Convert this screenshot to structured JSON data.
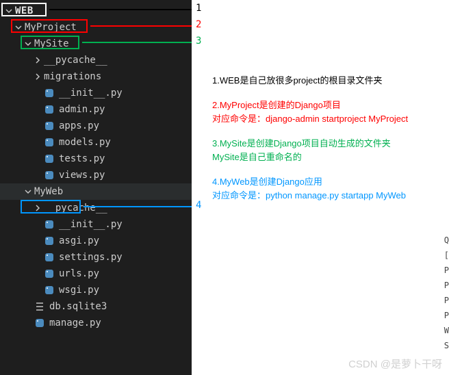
{
  "tree": {
    "root": "WEB",
    "project": "MyProject",
    "site": "MySite",
    "site_children": [
      {
        "name": "__pycache__",
        "type": "folder"
      },
      {
        "name": "migrations",
        "type": "folder"
      },
      {
        "name": "__init__.py",
        "type": "py"
      },
      {
        "name": "admin.py",
        "type": "py"
      },
      {
        "name": "apps.py",
        "type": "py"
      },
      {
        "name": "models.py",
        "type": "py"
      },
      {
        "name": "tests.py",
        "type": "py"
      },
      {
        "name": "views.py",
        "type": "py"
      }
    ],
    "myweb": "MyWeb",
    "myweb_children": [
      {
        "name": "__pycache__",
        "type": "folder"
      },
      {
        "name": "__init__.py",
        "type": "py"
      },
      {
        "name": "asgi.py",
        "type": "py"
      },
      {
        "name": "settings.py",
        "type": "py"
      },
      {
        "name": "urls.py",
        "type": "py"
      },
      {
        "name": "wsgi.py",
        "type": "py"
      }
    ],
    "tail": [
      {
        "name": "db.sqlite3",
        "type": "db"
      },
      {
        "name": "manage.py",
        "type": "py"
      }
    ]
  },
  "labels": {
    "n1": "1",
    "n2": "2",
    "n3": "3",
    "n4": "4"
  },
  "annotations": {
    "a1": "1.WEB是自己放很多project的根目录文件夹",
    "a2a": "2.MyProject是创建的Django项目",
    "a2b": "对应命令是：django-admin startproject MyProject",
    "a3a": "3.MySite是创建Django项目自动生成的文件夹",
    "a3b": "MySite是自己重命名的",
    "a4a": "4.MyWeb是创建Django应用",
    "a4b": "对应命令是：python manage.py startapp MyWeb"
  },
  "watermark": "CSDN @是萝卜干呀",
  "cut_chars": [
    "Q",
    "[",
    "P",
    "P",
    "P",
    "P",
    "W",
    "S"
  ],
  "colors": {
    "bg_sidebar": "#1e1e1e",
    "text": "#cccccc",
    "box_white": "#ffffff",
    "box_red": "#ff0000",
    "box_green": "#00b050",
    "box_blue": "#0096ff",
    "py_icon": "#4b8bbe"
  }
}
